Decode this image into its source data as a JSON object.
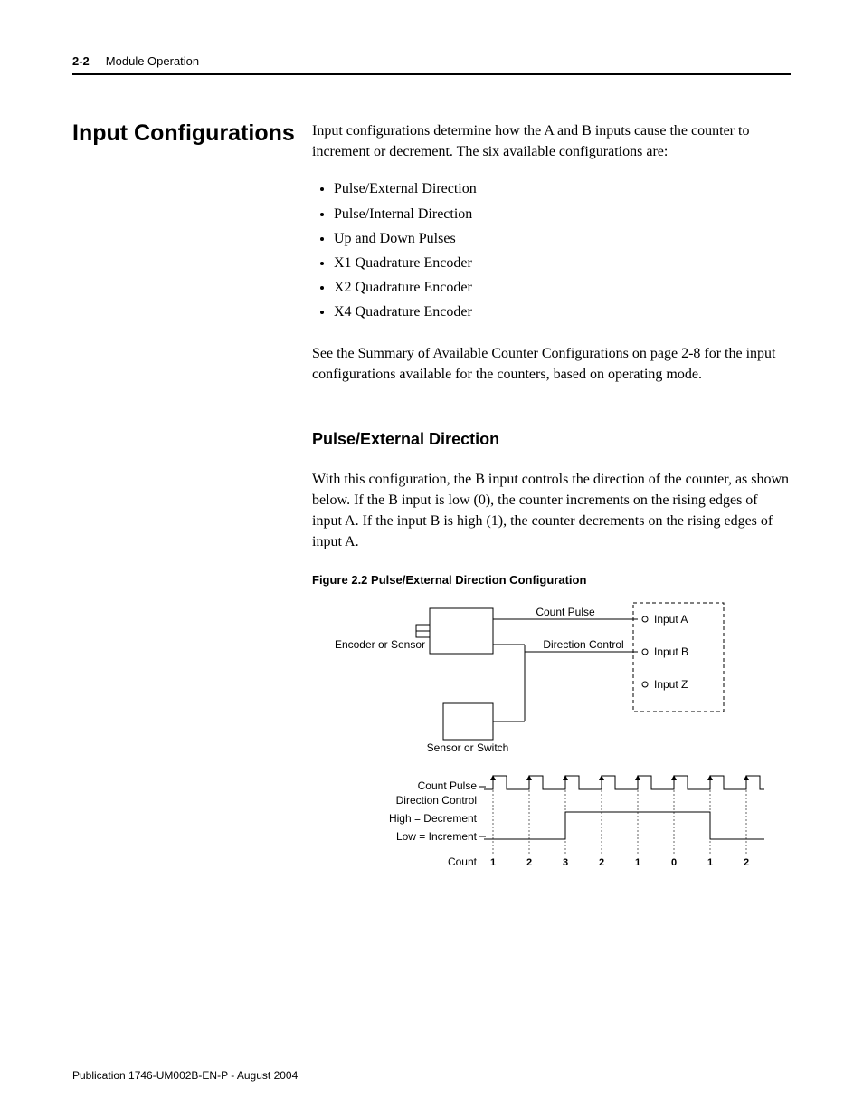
{
  "header": {
    "page_number": "2-2",
    "chapter_title": "Module Operation"
  },
  "section": {
    "title": "Input Configurations",
    "intro": "Input configurations determine how the A and B inputs cause the counter to increment or decrement. The six available configurations are:",
    "items": [
      "Pulse/External Direction",
      "Pulse/Internal Direction",
      "Up and Down Pulses",
      "X1 Quadrature Encoder",
      "X2 Quadrature Encoder",
      "X4 Quadrature Encoder"
    ],
    "after_list": "See the Summary of Available Counter Configurations on page 2-8 for the input configurations available for the counters, based on operating mode."
  },
  "subsection": {
    "title": "Pulse/External Direction",
    "body": "With this configuration, the B input controls the direction of the counter, as shown below. If the B input is low (0), the counter increments on the rising edges of input A. If the input B is high (1), the counter decrements on the rising edges of input A.",
    "figure_caption": "Figure 2.2 Pulse/External Direction Configuration"
  },
  "diagram": {
    "encoder_label": "Encoder or Sensor",
    "sensor_label": "Sensor or Switch",
    "count_pulse_label": "Count Pulse",
    "direction_control_label": "Direction Control",
    "input_a": "Input A",
    "input_b": "Input B",
    "input_z": "Input Z",
    "wave_count_pulse": "Count Pulse",
    "wave_dir_line1": "Direction Control",
    "wave_dir_line2": "High = Decrement",
    "wave_dir_line3": "Low = Increment",
    "wave_count_label": "Count",
    "counts": [
      "1",
      "2",
      "3",
      "2",
      "1",
      "0",
      "1",
      "2"
    ]
  },
  "footer": "Publication 1746-UM002B-EN-P - August 2004"
}
